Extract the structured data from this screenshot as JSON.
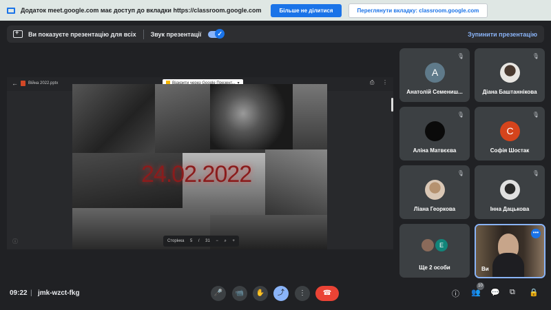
{
  "sharing_bar": {
    "message": "Додаток meet.google.com має доступ до вкладки https://classroom.google.com",
    "stop_sharing_label": "Більше не ділитися",
    "view_tab_label": "Переглянути вкладку: classroom.google.com"
  },
  "presentation_bar": {
    "status": "Ви показуєте презентацію для всіх",
    "sound_label": "Звук презентації",
    "sound_on": true,
    "stop_label": "Зупинити презентацію"
  },
  "shared_screen": {
    "file_name": "Війна 2022.pptx",
    "open_with_label": "Відкрити через Google Презент...",
    "slide_text": "24.02.2022",
    "pager_label": "Сторінка",
    "current_page": "5",
    "page_separator": "/",
    "total_pages": "31"
  },
  "participants": [
    {
      "name": "Анатолій Семениш...",
      "initial": "А",
      "color": "#5f7a8a",
      "muted": true,
      "photo": false
    },
    {
      "name": "Діана Баштаннікова",
      "initial": "",
      "color": "#e8e6e2",
      "muted": true,
      "photo": true
    },
    {
      "name": "Аліна Матвєєва",
      "initial": "",
      "color": "#0a0a0a",
      "muted": true,
      "photo": false
    },
    {
      "name": "Софія Шостак",
      "initial": "С",
      "color": "#d5441c",
      "muted": true,
      "photo": false
    },
    {
      "name": "Ліана Георкова",
      "initial": "",
      "color": "#d9c7b5",
      "muted": true,
      "photo": true
    },
    {
      "name": "Інна Дацькова",
      "initial": "",
      "color": "#e0e0e0",
      "muted": true,
      "photo": true
    }
  ],
  "more_participants": {
    "label": "Ще 2 особи",
    "initial": "E",
    "color": "#12857a"
  },
  "self_tile": {
    "label": "Ви"
  },
  "bottom_bar": {
    "time": "09:22",
    "divider": "|",
    "meeting_code": "jmk-wzct-fkg",
    "participant_count": "10"
  },
  "icons": {
    "mic": "🎤",
    "camera": "📹",
    "hand": "✋",
    "present": "⤴",
    "more": "⋮",
    "hangup": "☎",
    "info": "ⓘ",
    "people": "👥",
    "chat": "💬",
    "activities": "⧉",
    "lock": "🔒",
    "mic_off": "🎙"
  }
}
